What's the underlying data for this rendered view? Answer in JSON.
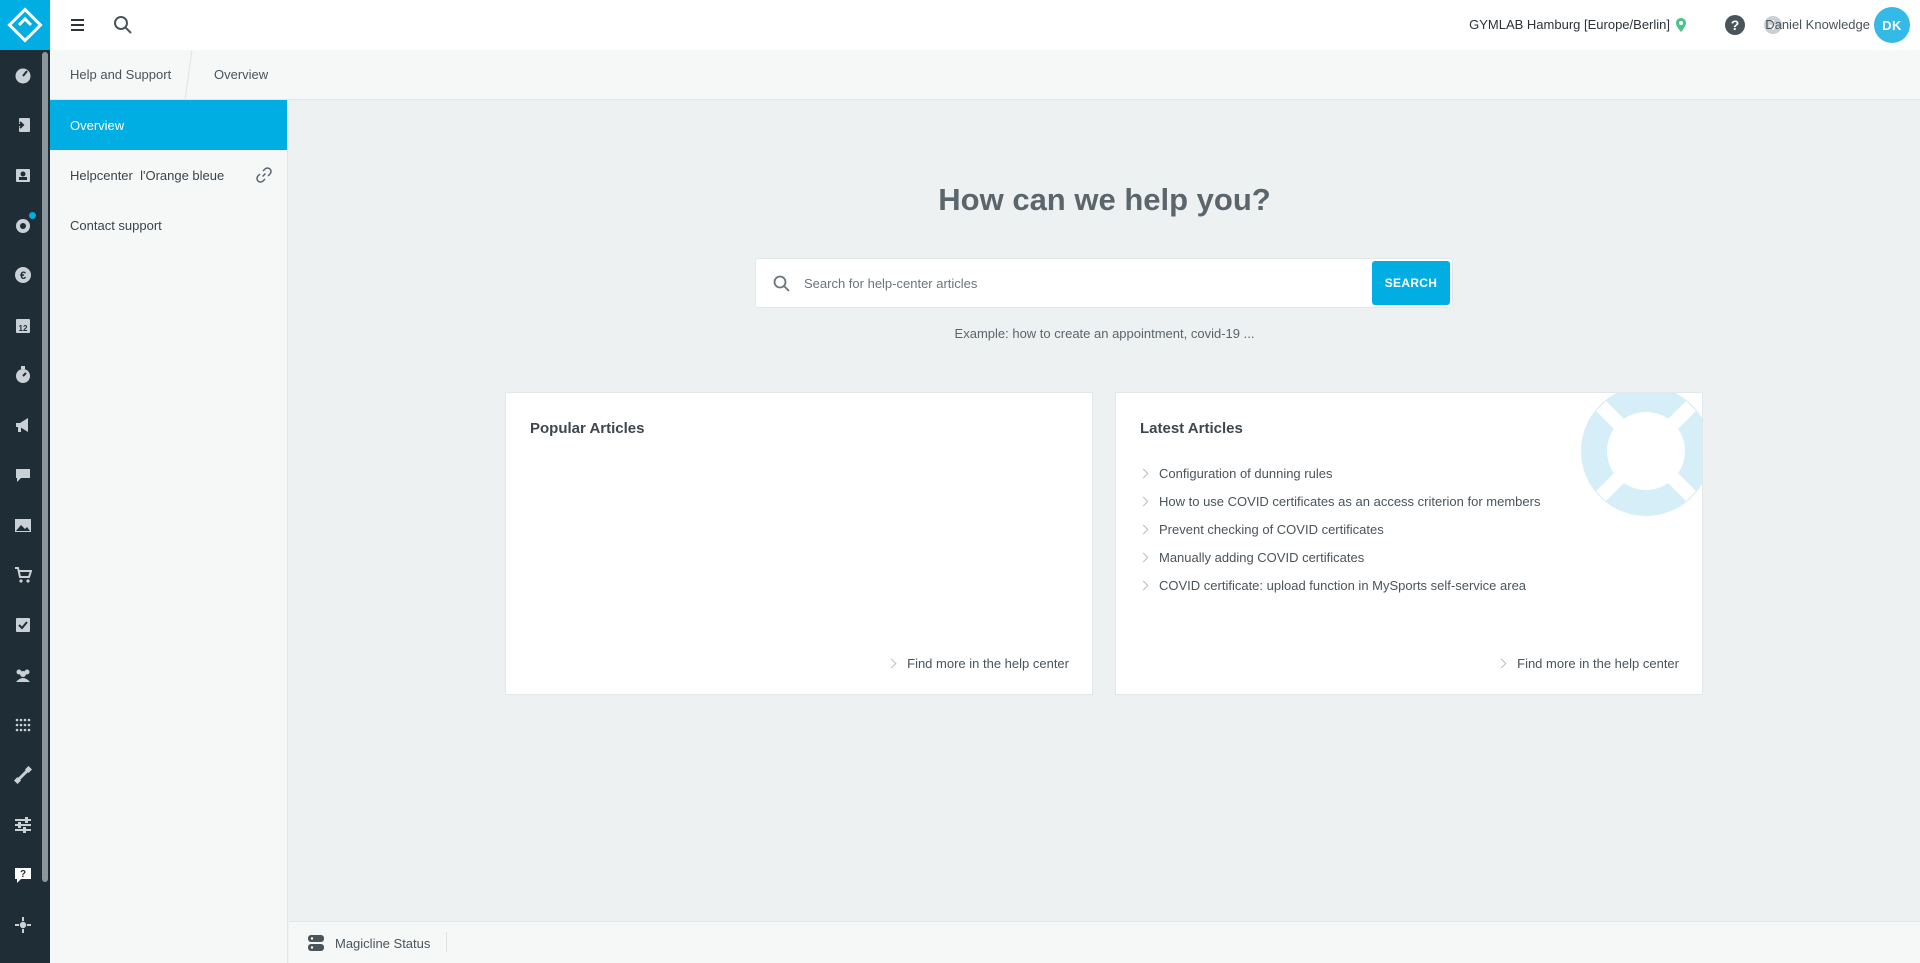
{
  "topbar": {
    "studio": "GYMLAB Hamburg [Europe/Berlin]",
    "user_name": "Daniel Knowledge",
    "user_initials": "DK"
  },
  "rail": {
    "items": [
      {
        "icon": "dashboard-icon"
      },
      {
        "icon": "check-in-icon"
      },
      {
        "icon": "members-icon"
      },
      {
        "icon": "settings-notification-icon"
      },
      {
        "icon": "finance-euro-icon"
      },
      {
        "icon": "calendar-icon"
      },
      {
        "icon": "timer-icon"
      },
      {
        "icon": "marketing-megaphone-icon"
      },
      {
        "icon": "chat-icon"
      },
      {
        "icon": "gallery-icon"
      },
      {
        "icon": "shop-cart-icon"
      },
      {
        "icon": "tasks-check-icon"
      },
      {
        "icon": "groups-icon"
      },
      {
        "icon": "grid-dots-icon"
      },
      {
        "icon": "equipment-icon"
      },
      {
        "icon": "sliders-icon"
      },
      {
        "icon": "help-support-icon"
      },
      {
        "icon": "integrations-icon"
      }
    ]
  },
  "breadcrumb": {
    "root": "Help and Support",
    "current": "Overview"
  },
  "subnav": {
    "items": [
      {
        "label": "Overview"
      },
      {
        "label": "Helpcenter  l'Orange bleue"
      },
      {
        "label": "Contact support"
      }
    ]
  },
  "main": {
    "headline": "How can we help you?",
    "search_placeholder": "Search for help-center articles",
    "search_button": "SEARCH",
    "example": "Example: how to create an appointment, covid-19 ..."
  },
  "popular": {
    "title": "Popular Articles",
    "more": "Find more in the help center"
  },
  "latest": {
    "title": "Latest Articles",
    "articles": [
      "Configuration of dunning rules",
      "How to use COVID certificates as an access criterion for members",
      "Prevent checking of COVID certificates",
      "Manually adding COVID certificates",
      "COVID certificate: upload function in MySports self-service area"
    ],
    "more": "Find more in the help center"
  },
  "footer": {
    "status": "Magicline Status"
  },
  "colors": {
    "accent": "#00aee4",
    "rail": "#1f2d36",
    "location_pin": "#4cc38a"
  }
}
